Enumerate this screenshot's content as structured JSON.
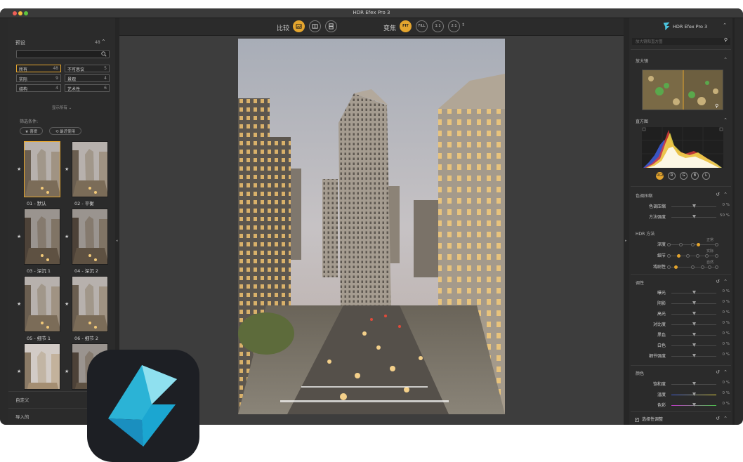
{
  "window": {
    "title": "HDR Efex Pro 3"
  },
  "left": {
    "header": "预设",
    "count": "48",
    "categories": [
      {
        "label": "所有",
        "count": "48"
      },
      {
        "label": "不可思议",
        "count": "5"
      },
      {
        "label": "实际",
        "count": "9"
      },
      {
        "label": "景观",
        "count": "4"
      },
      {
        "label": "结构",
        "count": "4"
      },
      {
        "label": "艺术性",
        "count": "6"
      }
    ],
    "show_all": "显示所有",
    "filter_label": "筛选条件:",
    "filter_fav": "★ 喜爱",
    "filter_recent": "⟲ 最近使用",
    "presets": [
      {
        "label": "01 - 默认"
      },
      {
        "label": "02 - 平衡"
      },
      {
        "label": "03 - 深沉 1"
      },
      {
        "label": "04 - 深沉 2"
      },
      {
        "label": "05 - 细节 1"
      },
      {
        "label": "06 - 细节 2"
      },
      {
        "label": ""
      },
      {
        "label": ""
      }
    ],
    "custom": "自定义",
    "imported": "导入的"
  },
  "toolbar": {
    "compare_label": "比较",
    "zoom_label": "变焦",
    "fit": "FIT",
    "fill": "FILL",
    "z11": "1:1",
    "z21": "2:1"
  },
  "right": {
    "logo_text": "HDR Efex Pro 3",
    "sub_placeholder": "放大镜和直方图",
    "loupe_title": "放大镜",
    "histogram_title": "直方图",
    "channels": [
      "RGB",
      "R",
      "G",
      "B",
      "L"
    ],
    "tone_title": "色调压缩",
    "tone_sliders": [
      {
        "label": "色调压缩",
        "value": "0 %"
      },
      {
        "label": "方法强度",
        "value": "50 %"
      }
    ],
    "hdr_title": "HDR 方法",
    "hdr_rows": [
      {
        "label": "深度",
        "note": "正常"
      },
      {
        "label": "细节",
        "note": "实际"
      },
      {
        "label": "戏剧性",
        "note": "自然"
      }
    ],
    "adjust_title": "调性",
    "adjust_sliders": [
      {
        "label": "曝光",
        "value": "0 %"
      },
      {
        "label": "阴影",
        "value": "0 %"
      },
      {
        "label": "高光",
        "value": "0 %"
      },
      {
        "label": "对比度",
        "value": "0 %"
      },
      {
        "label": "黑色",
        "value": "0 %"
      },
      {
        "label": "白色",
        "value": "0 %"
      },
      {
        "label": "细节强度",
        "value": "0 %"
      }
    ],
    "color_title": "颜色",
    "color_sliders": [
      {
        "label": "饱和度",
        "value": "0 %"
      },
      {
        "label": "温度",
        "value": "0 %"
      },
      {
        "label": "色彩",
        "value": "0 %"
      }
    ],
    "selective_label": "选择性调整"
  },
  "colors": {
    "accent": "#e4a52e",
    "panel": "#2b2b2b",
    "canvas": "#3d3d3d"
  }
}
